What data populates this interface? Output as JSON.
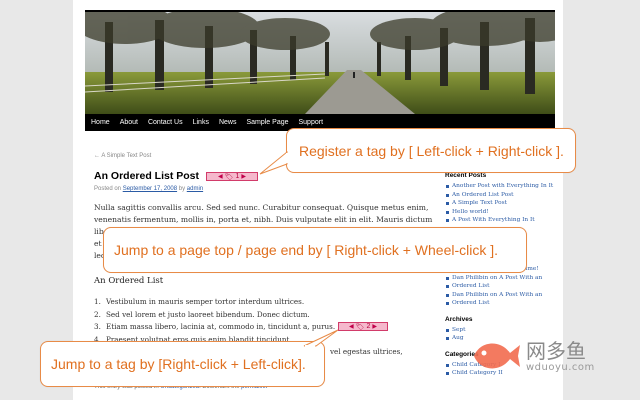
{
  "nav": {
    "items": [
      "Home",
      "About",
      "Contact Us",
      "Links",
      "News",
      "Sample Page",
      "Support"
    ]
  },
  "breadcrumb": "← A Simple Text Post",
  "post": {
    "title": "An Ordered List Post",
    "meta_prefix": "Posted on",
    "meta_date": "September 17, 2008",
    "meta_by": "by",
    "meta_author": "admin",
    "paragraph1": "Nulla sagittis convallis arcu. Sed sed nunc. Curabitur consequat. Quisque metus enim, venenatis fermentum, mollis in, porta et, nibh. Duis vulputate elit in elit. Mauris dictum libero id",
    "paragraph2": "et",
    "paragraph2b": "lectus",
    "subheading": "An Ordered List",
    "list": [
      {
        "num": "1.",
        "text": "Vestibulum in mauris semper tortor interdum ultrices."
      },
      {
        "num": "2.",
        "text": "Sed vel lorem et justo laoreet bibendum. Donec dictum."
      },
      {
        "num": "3.",
        "text": "Etiam massa libero, lacinia at, commodo in, tincidunt a, purus."
      },
      {
        "num": "4.",
        "text": "Praesent volutpat eros quis enim blandit tincidunt."
      },
      {
        "num": "5.",
        "text": "vel egestas ultrices,"
      }
    ],
    "footer_text": "This entry was posted in",
    "footer_cat": "Uncategorized",
    "footer_bookmark": "Bookmark the",
    "footer_permalink": "permalink"
  },
  "tags": [
    {
      "label": "1"
    },
    {
      "label": "2"
    }
  ],
  "sidebar": {
    "recent_title": "Recent Posts",
    "recent": [
      "Another Post with Everything In It",
      "An Ordered List Post",
      "A Simple Text Post",
      "Hello world!",
      "A Post With Everything In It"
    ],
    "comments": [
      "Everything In It",
      "Dan Philibin on Quotes Time!",
      "Dan Philibin on A Post With an",
      "Ordered List",
      "Dan Philibin on A Post With an",
      "Ordered List"
    ],
    "archives_title": "Archives",
    "archives": [
      "Sept",
      "Aug"
    ],
    "categories_title": "Categories",
    "categories": [
      "Child Category I",
      "Child Category II"
    ]
  },
  "callouts": {
    "register": "Register a tag by [ Left-click + Right-click ].",
    "jump_page": "Jump to a page top / page end by [ Right-click + Wheel-click ].",
    "jump_tag": "Jump to a tag by [Right-click + Left-click]."
  },
  "watermark": {
    "cn": "网多鱼",
    "url": "wduoyu.com"
  },
  "colors": {
    "accent": "#e07020",
    "link": "#2b5ba5",
    "tag_fill": "#f5b8cc",
    "tag_border": "#d23b6a"
  }
}
